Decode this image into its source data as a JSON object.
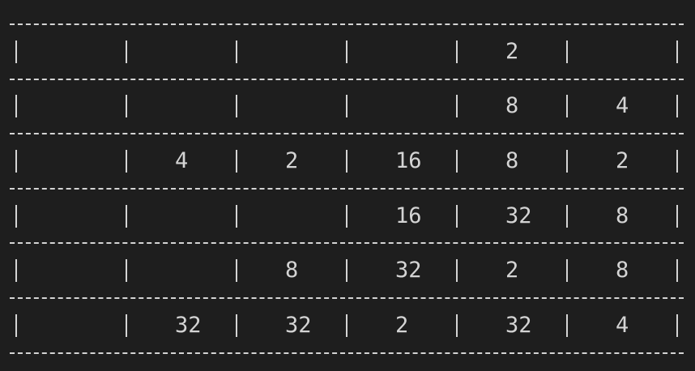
{
  "board": {
    "rows": [
      [
        "",
        "",
        "",
        "",
        "2",
        ""
      ],
      [
        "",
        "",
        "",
        "",
        "8",
        "4"
      ],
      [
        "",
        "4",
        "2",
        "16",
        "8",
        "2"
      ],
      [
        "",
        "",
        "",
        "16",
        "32",
        "8"
      ],
      [
        "",
        "",
        "8",
        "32",
        "2",
        "8"
      ],
      [
        "",
        "32",
        "32",
        "2",
        "32",
        "4"
      ]
    ]
  },
  "colors": {
    "background": "#1e1e1e",
    "text": "#d4d4d4"
  }
}
